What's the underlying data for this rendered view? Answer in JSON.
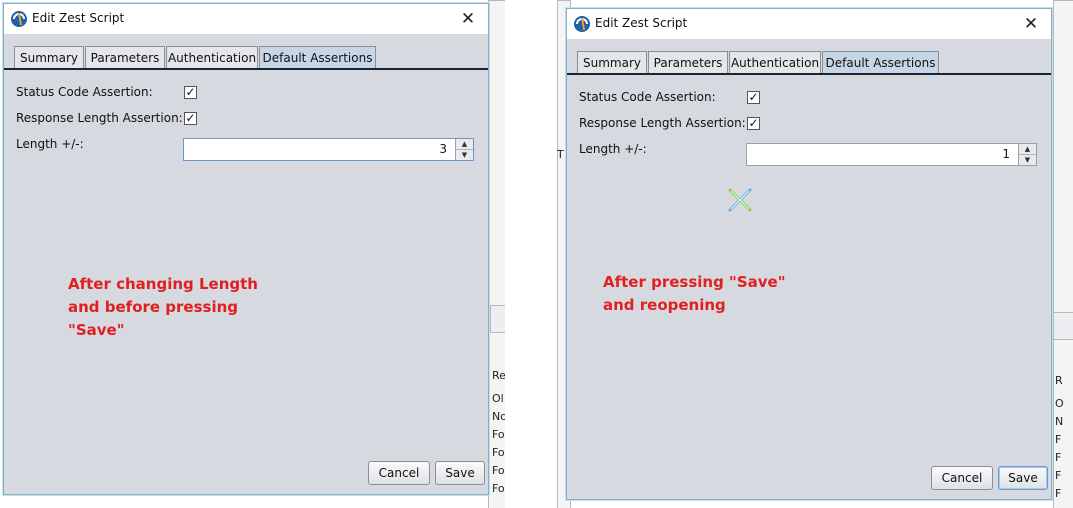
{
  "left_panel": {
    "window_title": "Edit Zest Script",
    "tabs": [
      "Summary",
      "Parameters",
      "Authentication",
      "Default Assertions"
    ],
    "status_code_label": "Status Code Assertion:",
    "status_code_checked": true,
    "response_length_label": "Response Length Assertion:",
    "response_length_checked": true,
    "length_label": "Length +/-:",
    "length_value": "3",
    "cancel_label": "Cancel",
    "save_label": "Save",
    "annotation_lines": [
      "After changing Length",
      "and before pressing",
      "\"Save\""
    ]
  },
  "right_panel": {
    "window_title": "Edit Zest Script",
    "tabs": [
      "Summary",
      "Parameters",
      "Authentication",
      "Default Assertions"
    ],
    "status_code_label": "Status Code Assertion:",
    "status_code_checked": true,
    "response_length_label": "Response Length Assertion:",
    "response_length_checked": true,
    "length_label": "Length +/-:",
    "length_value": "1",
    "cancel_label": "Cancel",
    "save_label": "Save",
    "annotation_lines": [
      "After pressing \"Save\"",
      "and reopening"
    ]
  },
  "background_app": {
    "left_column_header": "Re",
    "left_rows": [
      "Ol",
      "No",
      "Fo",
      "Fo",
      "Fo",
      "Fo"
    ],
    "right_column_header": "R",
    "right_rows": [
      "O",
      "N",
      "F",
      "F",
      "F",
      "F"
    ],
    "right_side_letter": "T"
  },
  "colors": {
    "dialog_bg": "#d6d9df",
    "active_tab": "#c7d6e7",
    "annotation": "#e02020"
  }
}
